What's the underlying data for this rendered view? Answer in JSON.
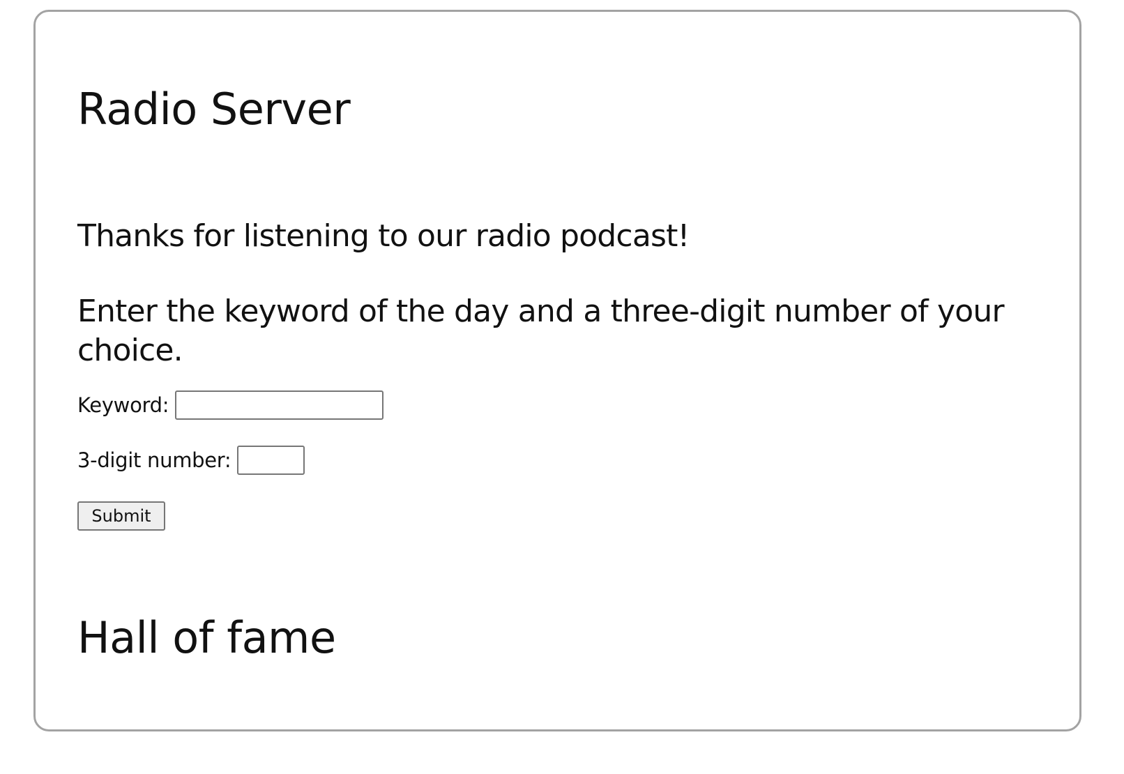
{
  "page": {
    "title": "Radio Server",
    "intro": "Thanks for listening to our radio podcast!",
    "instructions": "Enter the keyword of the day and a three-digit number of your choice."
  },
  "form": {
    "keyword_label": "Keyword:",
    "keyword_value": "",
    "number_label": "3-digit number:",
    "number_value": "",
    "submit_label": "Submit"
  },
  "hall_of_fame": {
    "title": "Hall of fame",
    "entries": []
  },
  "colors": {
    "card_border": "#a3a3a3",
    "text": "#111111",
    "button_bg": "#efefef"
  }
}
